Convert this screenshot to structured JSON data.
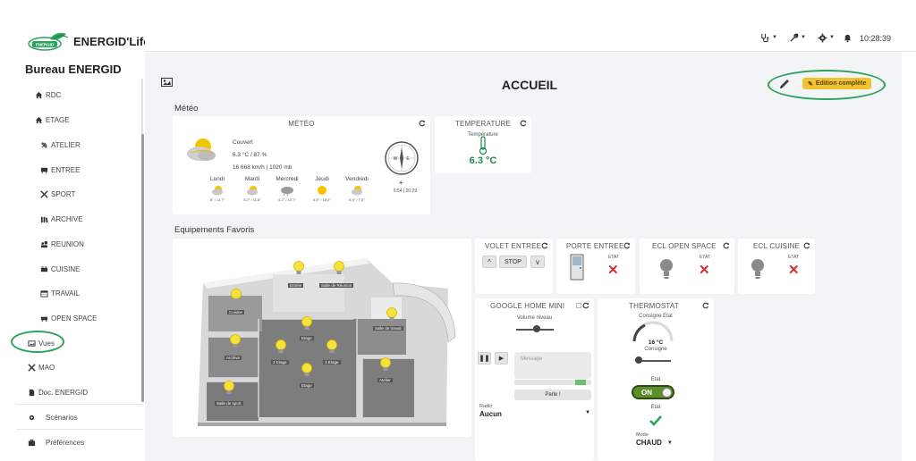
{
  "brand": {
    "logo_text": "ENERGID",
    "name": "ENERGID'Life"
  },
  "site": {
    "name": "Bureau ENERGID"
  },
  "nav": {
    "items": [
      {
        "label": "RDC",
        "icon": "home-icon"
      },
      {
        "label": "ETAGE",
        "icon": "home-icon"
      },
      {
        "label": "ATELIER",
        "icon": "tools-icon"
      },
      {
        "label": "ENTREE",
        "icon": "desk-icon"
      },
      {
        "label": "SPORT",
        "icon": "sport-icon"
      },
      {
        "label": "ARCHIVE",
        "icon": "archive-icon"
      },
      {
        "label": "REUNION",
        "icon": "meeting-icon"
      },
      {
        "label": "CUISINE",
        "icon": "kitchen-icon"
      },
      {
        "label": "TRAVAIL",
        "icon": "calendar-icon"
      },
      {
        "label": "OPEN SPACE",
        "icon": "openspace-icon"
      },
      {
        "label": "Vues",
        "icon": "image-icon"
      },
      {
        "label": "MAO",
        "icon": "tools-icon"
      },
      {
        "label": "Doc. ENERGID",
        "icon": "file-icon"
      }
    ],
    "scenarios": "Scénarios",
    "preferences": "Préférences"
  },
  "topbar": {
    "time": "10:28:39"
  },
  "page": {
    "title": "ACCUEIL",
    "edit_label": "Edition complète"
  },
  "meteo": {
    "section": "Météo",
    "card_title": "MÉTÉO",
    "condition": "Couvert",
    "temp_humidity": "6.3 °C / 87 %",
    "wind_pressure": "16.668 km/h | 1020 mb",
    "compass_n": "W",
    "compass_e": "E",
    "sun": "6:54 | 20:29",
    "forecast": [
      {
        "day": "Lundi",
        "range": "8° / 11.7°"
      },
      {
        "day": "Mardi",
        "range": "5.2° / 11.8°"
      },
      {
        "day": "Mercredi",
        "range": "4.2° / 10.7°"
      },
      {
        "day": "Jeudi",
        "range": "6.8° / 18.3°"
      },
      {
        "day": "Vendredi",
        "range": "8.9° / 7.8°"
      }
    ]
  },
  "temperature": {
    "card_title": "TEMPERATURE",
    "label": "Température",
    "value": "6.3 °C"
  },
  "favoris": {
    "section": "Equipements Favoris",
    "rooms": [
      "Entrée",
      "Salle de Réunion",
      "Cuisine",
      "Etage",
      "Salle de travail",
      "Archive",
      "2 Etage",
      "3 Etage",
      "Etage",
      "Atelier",
      "Salle de sport"
    ]
  },
  "volet": {
    "title": "VOLET ENTREE",
    "up": "^",
    "stop": "STOP",
    "down": "v"
  },
  "porte": {
    "title": "PORTE ENTREE",
    "etat": "ETAT",
    "state": "✕"
  },
  "ecl_open": {
    "title": "ECL OPEN SPACE",
    "etat": "ETAT",
    "state": "✕"
  },
  "ecl_cuisine": {
    "title": "ECL CUISINE",
    "etat": "ETAT",
    "state": "✕"
  },
  "google": {
    "title": "GOOGLE HOME MINI",
    "volume_label": "Volume niveau",
    "volume": 0.55,
    "message_placeholder": "Message",
    "parle": "Parle !",
    "radio_label": "Radio",
    "radio_value": "Aucun"
  },
  "thermostat": {
    "title": "THERMOSTAT",
    "consigne_etat": "Consigne Etat",
    "consigne_value": "16 °C",
    "consigne_label": "Consigne",
    "etat_label": "Etat",
    "toggle": "ON",
    "etat2_label": "Etat",
    "mode_label": "Mode",
    "mode_value": "CHAUD"
  },
  "colors": {
    "accent_green": "#2aa35e",
    "edit_yellow": "#f1c232",
    "temp_green": "#1a8a4a",
    "red": "#d32f2f"
  }
}
